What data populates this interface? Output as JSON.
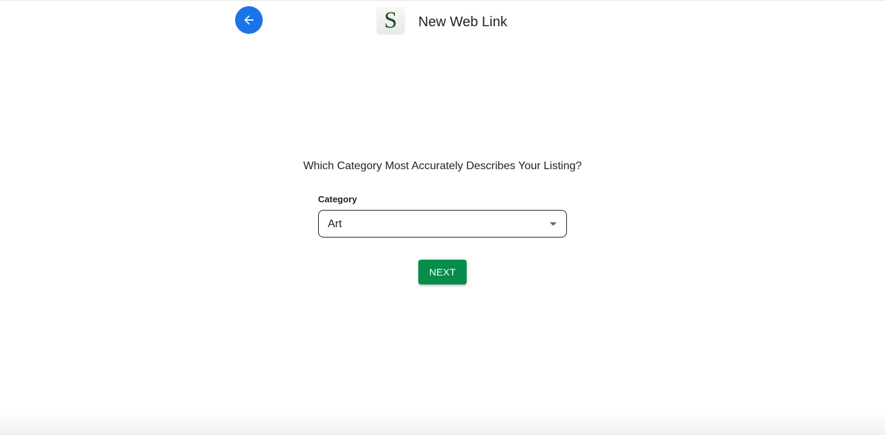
{
  "header": {
    "back_icon": "arrow-left-icon",
    "logo_letter": "S",
    "title": "New Web Link"
  },
  "main": {
    "question": "Which Category Most Accurately Describes Your Listing?",
    "category_field": {
      "label": "Category",
      "selected_value": "Art",
      "caret_icon": "caret-down-icon"
    },
    "next_label": "NEXT"
  },
  "colors": {
    "back_button": "#1a73e8",
    "next_button": "#068c4b",
    "logo_letter": "#1e4d2b"
  }
}
